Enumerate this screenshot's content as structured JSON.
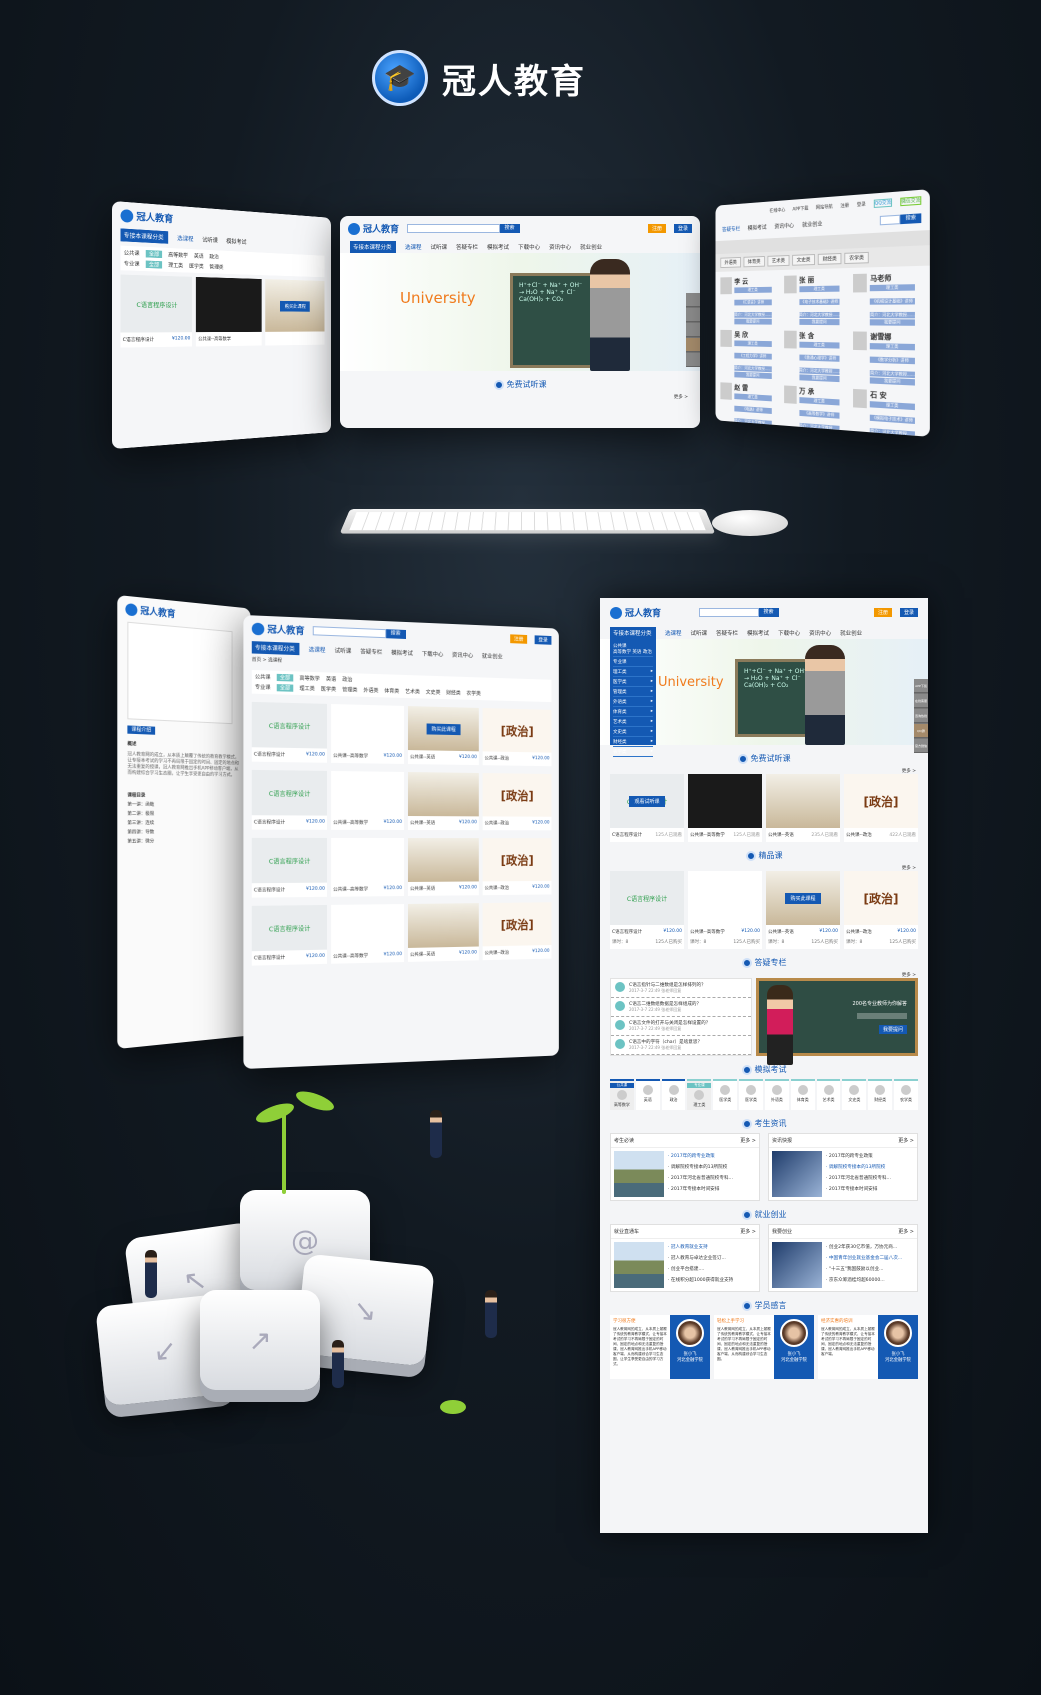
{
  "brand": {
    "name": "冠人教育",
    "logo_icon": "graduation-cap-globe-icon",
    "accent": "#1459b3",
    "orange": "#f39800"
  },
  "site": {
    "logo_text": "冠人教育",
    "search_button": "搜索",
    "register": "注册",
    "login": "登录",
    "category_button": "专接本课程分类",
    "nav": [
      "选课程",
      "试听课",
      "答疑专栏",
      "模拟考试",
      "下载中心",
      "资讯中心",
      "就业创业"
    ],
    "sidebar": {
      "public_heading": "公共课",
      "public_items": "高等数学  英语  政治",
      "major_heading": "专业课",
      "majors": [
        "理工类",
        "医学类",
        "管理类",
        "外语类",
        "体育类",
        "艺术类",
        "文史类",
        "财经类",
        "农学类"
      ]
    },
    "banner": {
      "headline": "University",
      "formula_1": "H⁺+Cl⁻ + Na⁺ + OH⁻",
      "formula_2": "→ H₂O + Na⁺ + Cl⁻",
      "formula_3": "Ca(OH)₂ + CO₂"
    },
    "more": "更多 >",
    "sections": {
      "free": "免费试听课",
      "premium": "精品课",
      "qa": "答疑专栏",
      "exam": "模拟考试",
      "news": "考生资讯",
      "career": "就业创业",
      "testimonials": "学员感言"
    },
    "free_courses": [
      {
        "thumb": "C语言程序设计",
        "overlay": "观看试听课",
        "title": "C语言程序设计",
        "count": "125人已观看"
      },
      {
        "thumb": "",
        "title": "公共课--高等数学",
        "count": "125人已观看"
      },
      {
        "thumb": "",
        "title": "公共课--英语",
        "count": "235人已观看"
      },
      {
        "thumb": "[政治]",
        "title": "公共课--政治",
        "count": "422人已观看"
      }
    ],
    "premium_courses": [
      {
        "thumb": "C语言程序设计",
        "title": "C语言程序设计",
        "price": "¥120.00",
        "hours": "课时：8",
        "count": "125人已购买"
      },
      {
        "thumb": "",
        "title": "公共课--高等数学",
        "price": "¥120.00",
        "hours": "课时：8",
        "count": "125人已购买"
      },
      {
        "thumb": "",
        "overlay": "购买此课程",
        "title": "公共课--英语",
        "price": "¥120.00",
        "hours": "课时：8",
        "count": "125人已购买"
      },
      {
        "thumb": "[政治]",
        "title": "公共课--政治",
        "price": "¥120.00",
        "hours": "课时：8",
        "count": "125人已购买"
      }
    ],
    "qa_items": [
      {
        "q": "C语言指针与二维数组是怎样排列的？",
        "meta": "2017-3-7 22:49  张老师回复"
      },
      {
        "q": "C语言二维数组数据是怎样组成的？",
        "meta": "2017-3-7 22:49  张老师回复"
      },
      {
        "q": "C语言文件的打开与关闭是怎样设置的？",
        "meta": "2017-3-7 22:49  张老师回复"
      },
      {
        "q": "C语言中的字符（char）是啥意思？",
        "meta": "2017-3-7 22:49  张老师回复"
      }
    ],
    "qa_board": {
      "headline": "200名专业教师为你解答",
      "button": "我要提问"
    },
    "exam_tags": {
      "public": "公共课",
      "major": "专业课"
    },
    "exam_items": [
      "高等数学",
      "英语",
      "政治",
      "理工类",
      "医学类",
      "医学类",
      "外语类",
      "体育类",
      "艺术类",
      "文史类",
      "财经类",
      "农学类"
    ],
    "news_boxes": [
      {
        "title": "考生必读",
        "items": [
          "2017年的跨专业政策",
          "调解院校专接本的13所院校",
          "2017年河北省普通院校专科...",
          "2017年专接本时间安排"
        ],
        "highlight": 0
      },
      {
        "title": "资讯快报",
        "items": [
          "2017年的跨专业政策",
          "调解院校专接本的13所院校",
          "2017年河北省普通院校专科...",
          "2017年专接本时间安排"
        ],
        "highlight": 1
      }
    ],
    "career_boxes": [
      {
        "title": "就业直通车",
        "items": [
          "冠人教育就业支持",
          "冠人教育与卓达企业签订...",
          "创业平台搭建....",
          "在线积分超1000获得就业支持"
        ],
        "highlight": 0
      },
      {
        "title": "我要创业",
        "items": [
          "创业2年获30亿市值，万协元商...",
          "中国青年创业就业基金会二届八次...",
          "\"十三五\"我国鼓励以创业...",
          "京东众筹酒桂均超60000..."
        ],
        "highlight": 1
      }
    ],
    "testimonials": [
      {
        "heading": "学习很方便",
        "body": "冠人教育网的成立，从本质上颠覆了传统的教育教学模式，让专接本考试的学习不再局限于固定的时间、固定的地点和无法重复的授课，冠人教育网推出手机APP移动客户端，从而构建综合学习生态圈，让学生享受更自由的学习方式。",
        "name": "张小飞",
        "school": "河北金融学院"
      },
      {
        "heading": "轻松上手学习",
        "body": "冠人教育网的成立，从本质上颠覆了传统的教育教学模式，让专接本考试的学习不再局限于固定的时间、固定的地点和无法重复的授课，冠人教育网推出手机APP移动客户端，从而构建综合学习生态圈。",
        "name": "张小飞",
        "school": "河北金融学院"
      },
      {
        "heading": "经济实惠的培训",
        "body": "冠人教育网的成立，从本质上颠覆了传统的教育教学模式，让专接本考试的学习不再局限于固定的时间、固定的地点和无法重复的授课，冠人教育网推出手机APP移动客户端。",
        "name": "张小飞",
        "school": "河北金融学院"
      }
    ],
    "side_tools": [
      "APP下载",
      "在线客服",
      "咨询热线",
      "QQ群",
      "官方微信"
    ]
  },
  "list_page": {
    "breadcrumb": "首页 > 选课程",
    "filter_public": "公共课",
    "filter_major": "专业课",
    "filter_all": "全部",
    "public_opts": [
      "高等数学",
      "英语",
      "政治"
    ],
    "major_opts": [
      "理工类",
      "医学类",
      "管理类",
      "外语类",
      "体育类",
      "艺术类",
      "文史类",
      "财经类",
      "农学类"
    ]
  },
  "teacher_page": {
    "top_links": [
      "在线中心",
      "APP下载",
      "网站导航"
    ],
    "qq": "QQ交流",
    "wechat": "微信交流",
    "nav": [
      "答疑专栏",
      "模拟考试",
      "资讯中心",
      "就业创业"
    ],
    "tabs": [
      "外语类",
      "体育类",
      "艺术类",
      "文史类",
      "财经类",
      "农学类"
    ],
    "ask": "我要提问",
    "teachers": [
      {
        "name": "李 云",
        "cat": "理工类",
        "course": "《C语言》讲师"
      },
      {
        "name": "张 丽",
        "cat": "理工类",
        "course": "《电子技术基础》讲师"
      },
      {
        "name": "马老师",
        "cat": "理工类",
        "course": "《机械设计基础》讲师"
      },
      {
        "name": "吴 欣",
        "cat": "理工类",
        "course": "《工程力学》讲师"
      },
      {
        "name": "张 含",
        "cat": "理工类",
        "course": "《普通心理学》讲师"
      },
      {
        "name": "谢雪娜",
        "cat": "理工类",
        "course": "《数学分析》讲师"
      },
      {
        "name": "赵 雷",
        "cat": "理工类",
        "course": "《电路》讲师"
      },
      {
        "name": "万 承",
        "cat": "理工类",
        "course": "《高等数学》讲师"
      },
      {
        "name": "石 安",
        "cat": "理工类",
        "course": "《模拟电子技术》讲师"
      }
    ],
    "intro": "简介：河北大学教授......"
  },
  "detail_page": {
    "tab": "课程介绍",
    "overview": "概述",
    "catalog": "课程目录",
    "chapters": [
      "第一讲：函数",
      "第二讲：极限",
      "第三讲：连续",
      "第四讲：导数",
      "第五讲：微分"
    ]
  }
}
